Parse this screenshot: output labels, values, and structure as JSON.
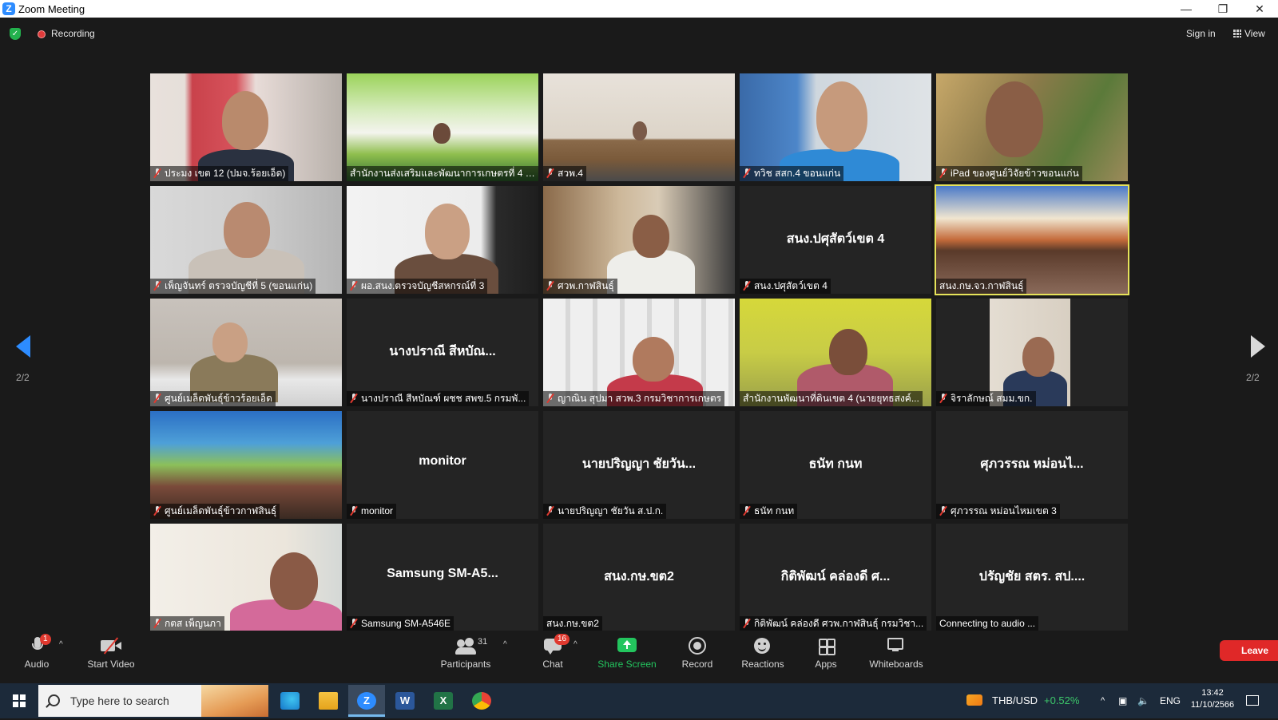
{
  "window": {
    "title": "Zoom Meeting",
    "controls": {
      "minimize": "—",
      "restore": "❐",
      "close": "✕"
    }
  },
  "topbar": {
    "recording_label": "Recording",
    "sign_in": "Sign in",
    "view": "View"
  },
  "paging": {
    "left": "2/2",
    "right": "2/2"
  },
  "tiles": [
    {
      "name": "ประมง เขต 12 (ปมจ.ร้อยเอ็ด)",
      "big": "",
      "muted": true
    },
    {
      "name": "สำนักงานส่งเสริมและพัฒนาการเกษตรที่ 4 ขอน...",
      "big": "",
      "muted": false
    },
    {
      "name": "สวพ.4",
      "big": "",
      "muted": true
    },
    {
      "name": "ทวิช สสก.4 ขอนแก่น",
      "big": "",
      "muted": true
    },
    {
      "name": "iPad ของศูนย์วิจัยข้าวขอนแก่น",
      "big": "",
      "muted": true
    },
    {
      "name": "เพ็ญจันทร์ ตรวจบัญชีที่ 5 (ขอนแก่น)",
      "big": "",
      "muted": true
    },
    {
      "name": "ผอ.สนง.ตรวจบัญชีสหกรณ์ที่ 3",
      "big": "",
      "muted": true
    },
    {
      "name": "ศวพ.กาฬสินธุ์",
      "big": "",
      "muted": true
    },
    {
      "name": "สนง.ปศุสัตว์เขต 4",
      "big": "สนง.ปศุสัตว์เขต 4",
      "muted": true
    },
    {
      "name": "สนง.กษ.จว.กาฬสินธุ์",
      "big": "",
      "muted": false
    },
    {
      "name": "ศูนย์เมล็ดพันธุ์ข้าวร้อยเอ็ด",
      "big": "",
      "muted": true
    },
    {
      "name": "นางปราณี สีหบัณฑ์ ผชช สพข.5 กรมพั...",
      "big": "นางปราณี สีหบัณ...",
      "muted": true
    },
    {
      "name": "ญาณิน สุปมา สวพ.3 กรมวิชาการเกษตร",
      "big": "",
      "muted": true
    },
    {
      "name": "สำนักงานพัฒนาที่ดินเขต 4 (นายยุทธสงค์...",
      "big": "",
      "muted": false
    },
    {
      "name": "จิราลักษณ์ สมม.ขก.",
      "big": "",
      "muted": true
    },
    {
      "name": "ศูนย์เมล็ดพันธุ์ข้าวกาฬสินธุ์",
      "big": "",
      "muted": true
    },
    {
      "name": "monitor",
      "big": "monitor",
      "muted": true
    },
    {
      "name": "นายปริญญา ชัยวัน ส.ป.ก.",
      "big": "นายปริญญา ชัยวัน...",
      "muted": true
    },
    {
      "name": "ธนัท กนท",
      "big": "ธนัท กนท",
      "muted": true
    },
    {
      "name": "ศุภวรรณ หม่อนไหมเขต 3",
      "big": "ศุภวรรณ หม่อนไ...",
      "muted": true
    },
    {
      "name": "กตส เพ็ญนภา",
      "big": "",
      "muted": true
    },
    {
      "name": "Samsung SM-A546E",
      "big": "Samsung  SM-A5...",
      "muted": true
    },
    {
      "name": "สนง.กษ.ขต2",
      "big": "สนง.กษ.ขต2",
      "muted": false
    },
    {
      "name": "กิติพัฒน์ คล่องดี ศวพ.กาฬสินธุ์ กรมวิชา...",
      "big": "กิติพัฒน์ คล่องดี ศ...",
      "muted": true
    },
    {
      "name": "Connecting to audio ...",
      "big": "ปรัญชัย สตร. สป....",
      "muted": false
    }
  ],
  "toolbar": {
    "audio": "Audio",
    "audio_badge": "1",
    "start_video": "Start Video",
    "participants": "Participants",
    "participants_count": "31",
    "chat": "Chat",
    "chat_badge": "16",
    "share_screen": "Share Screen",
    "record": "Record",
    "reactions": "Reactions",
    "apps": "Apps",
    "whiteboards": "Whiteboards",
    "leave": "Leave"
  },
  "taskbar": {
    "search_placeholder": "Type here to search",
    "ticker": "THB/USD",
    "ticker_change": "+0.52%",
    "lang": "ENG",
    "time": "13:42",
    "date": "11/10/2566"
  },
  "colors": {
    "zoom_blue": "#2d8cff",
    "share_green": "#23c55e",
    "leave_red": "#e02828",
    "active_speaker": "#e6e35a"
  }
}
